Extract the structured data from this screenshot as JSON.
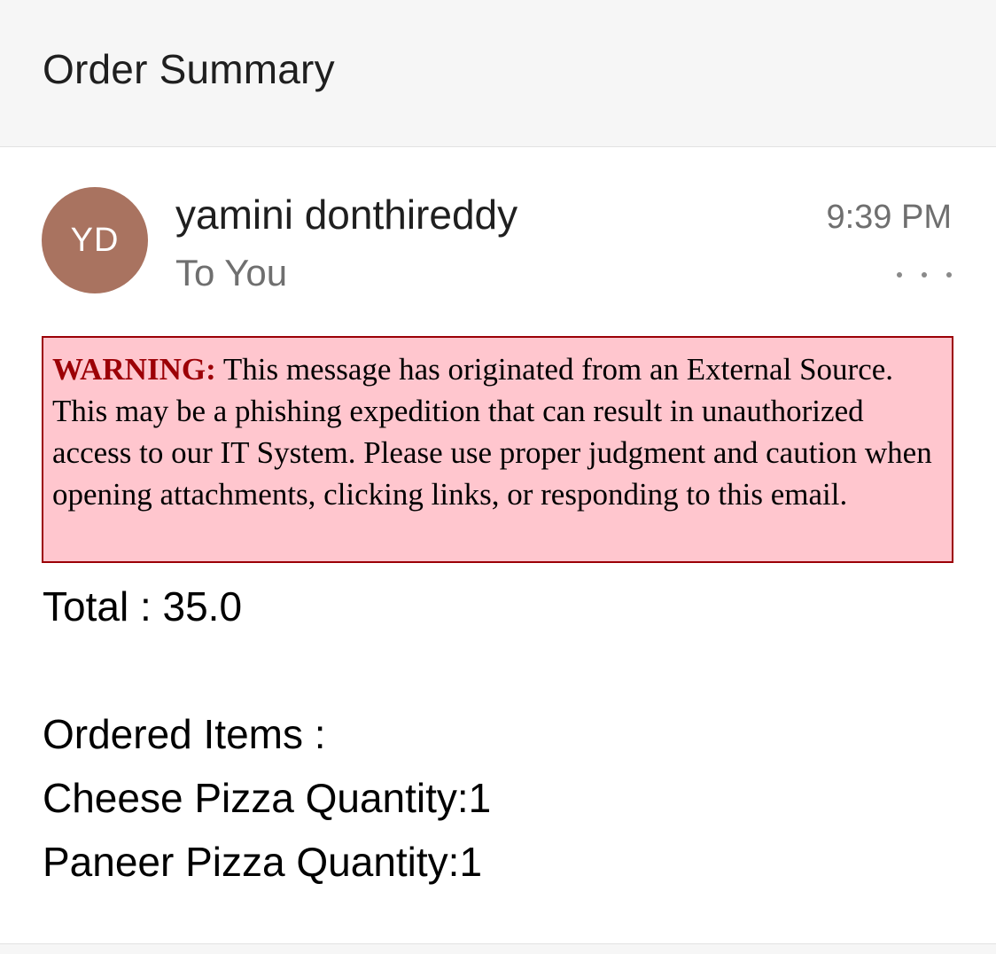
{
  "header": {
    "title": "Order Summary"
  },
  "message": {
    "sender": {
      "initials": "YD",
      "name": "yamini donthireddy",
      "avatar_color": "#a97360"
    },
    "recipient": "To You",
    "time": "9:39 PM",
    "more_icon": "more-horizontal-icon"
  },
  "warning": {
    "label": "WARNING:",
    "text": " This message has originated from an External Source. This may be a phishing expedition that can result in unauthorized access to our IT System. Please use proper judgment and caution when opening attachments, clicking links, or responding to this email.",
    "background_color": "#ffc6ce",
    "border_color": "#9c0006"
  },
  "body": {
    "total": "Total : 35.0",
    "items_heading": "Ordered Items :",
    "items": [
      "Cheese Pizza Quantity:1",
      "Paneer Pizza Quantity:1"
    ]
  }
}
